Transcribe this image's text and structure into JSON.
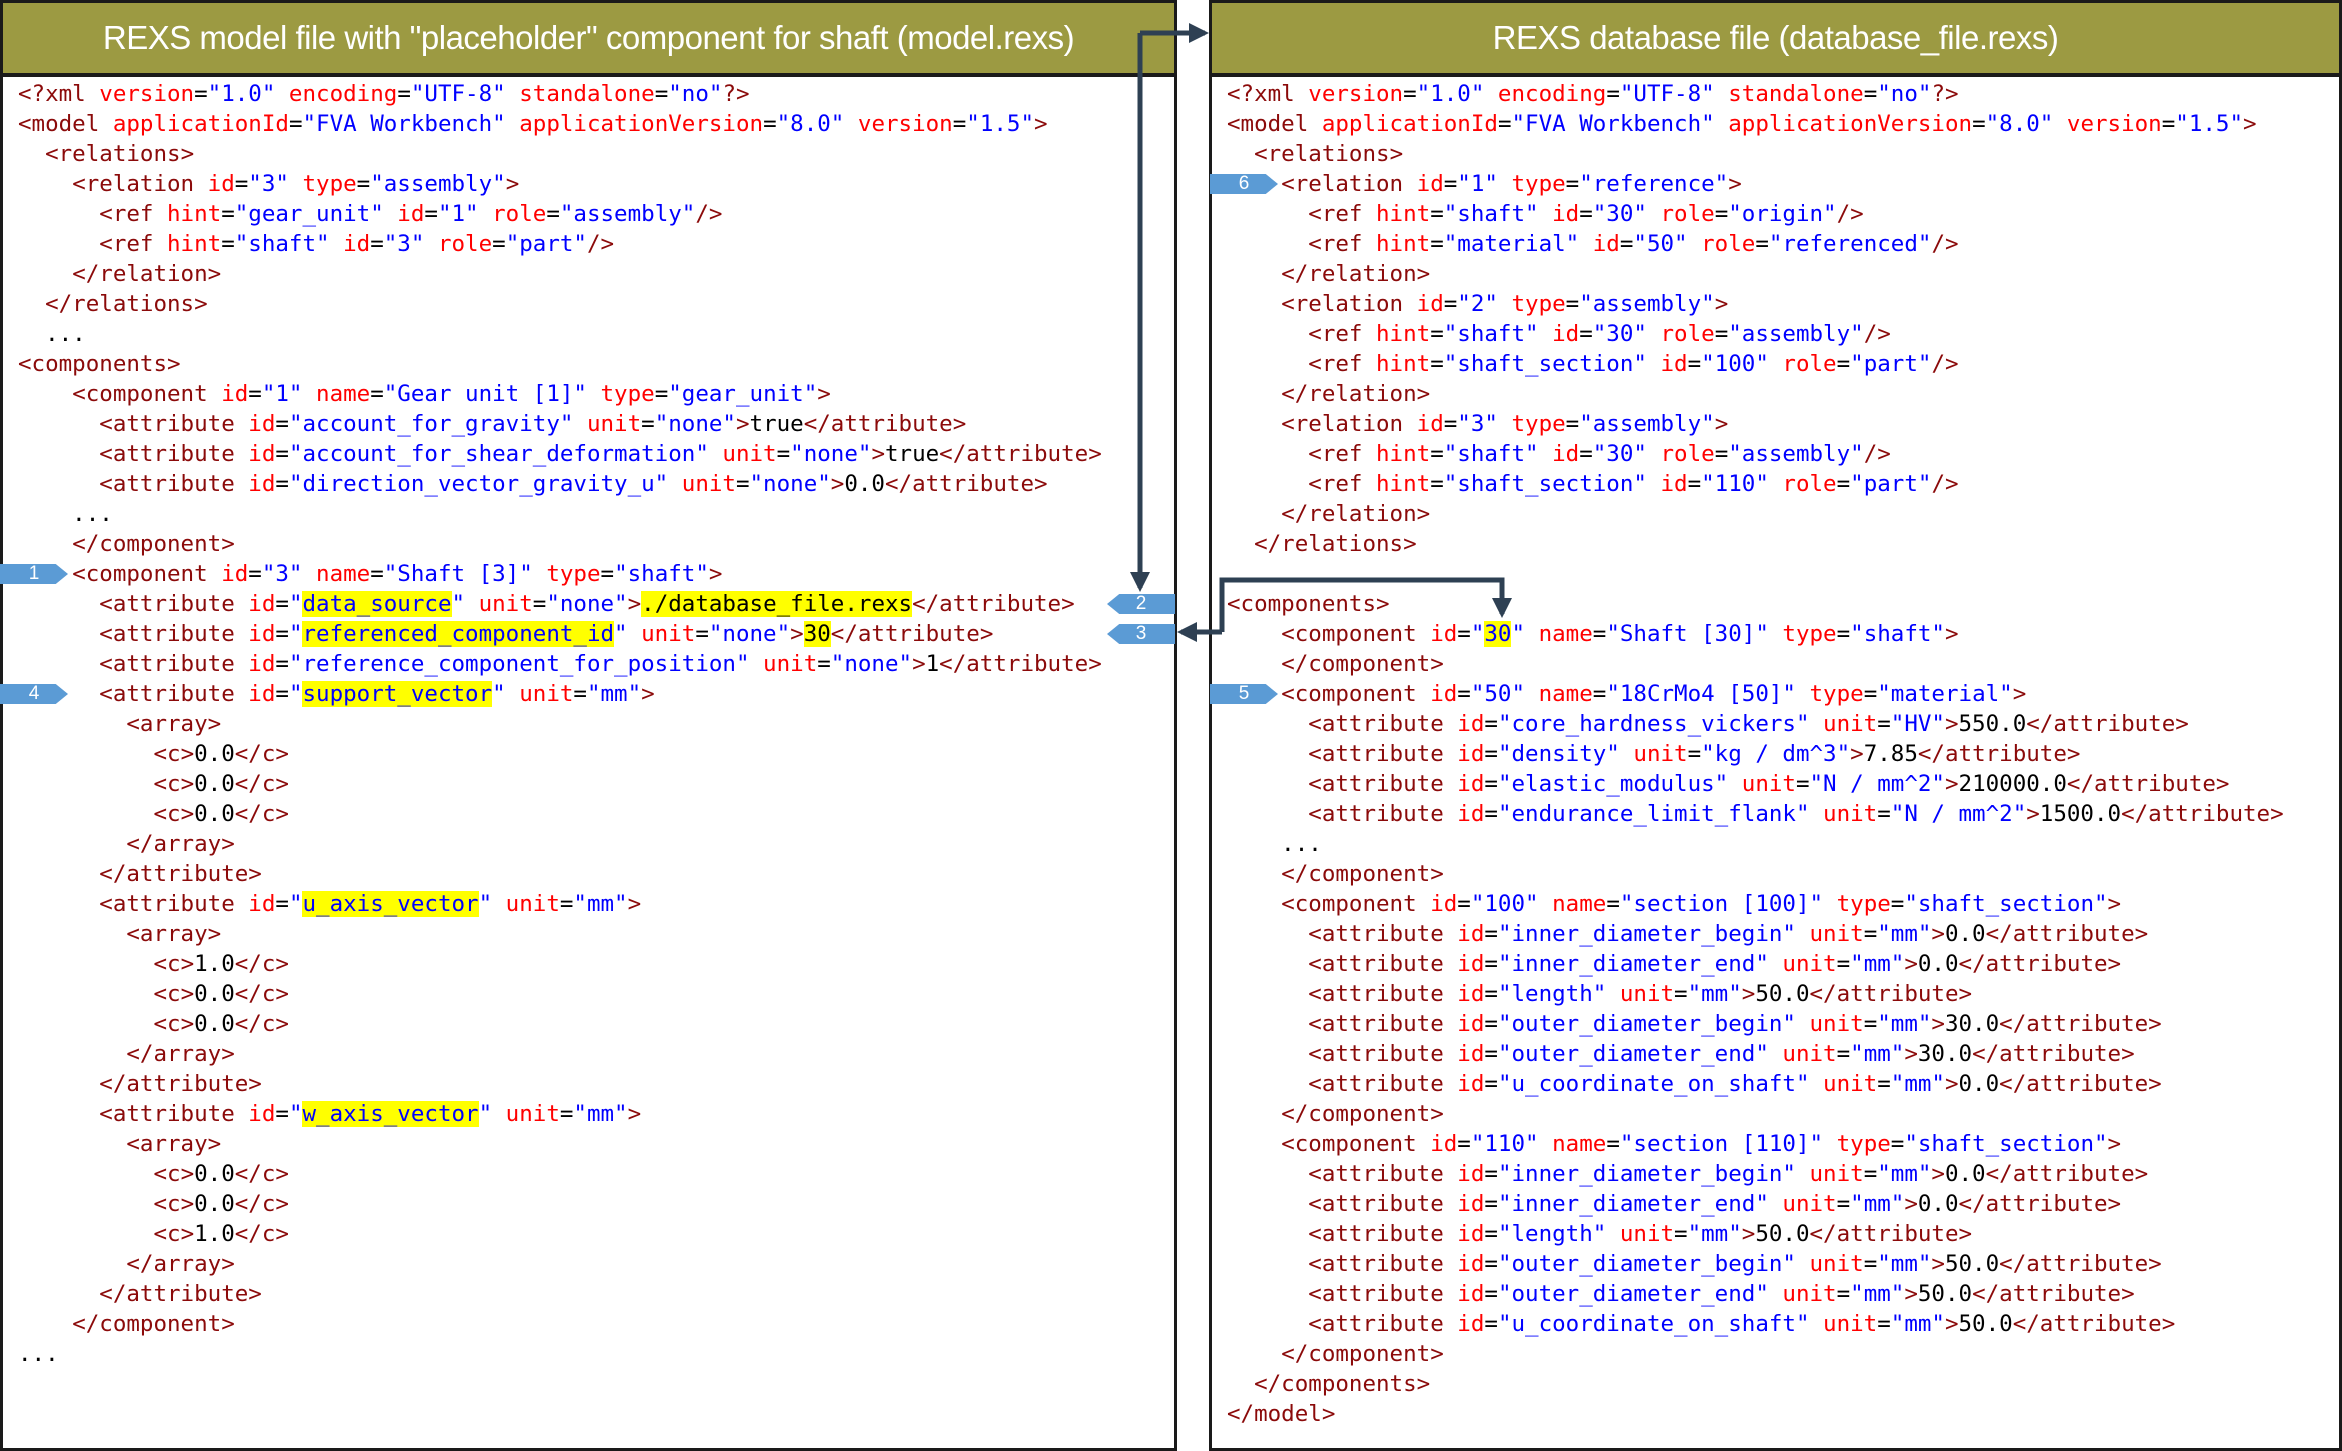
{
  "left_panel": {
    "title": "REXS model file with \"placeholder\" component for shaft (model.rexs)",
    "lines": [
      "<?xml version=\"1.0\" encoding=\"UTF-8\" standalone=\"no\"?>",
      "<model applicationId=\"FVA Workbench\" applicationVersion=\"8.0\" version=\"1.5\">",
      "  <relations>",
      "    <relation id=\"3\" type=\"assembly\">",
      "      <ref hint=\"gear_unit\" id=\"1\" role=\"assembly\"/>",
      "      <ref hint=\"shaft\" id=\"3\" role=\"part\"/>",
      "    </relation>",
      "  </relations>",
      "  ...",
      "<components>",
      "    <component id=\"1\" name=\"Gear unit [1]\" type=\"gear_unit\">",
      "      <attribute id=\"account_for_gravity\" unit=\"none\">true</attribute>",
      "      <attribute id=\"account_for_shear_deformation\" unit=\"none\">true</attribute>",
      "      <attribute id=\"direction_vector_gravity_u\" unit=\"none\">0.0</attribute>",
      "    ...",
      "    </component>",
      "    <component id=\"3\" name=\"Shaft [3]\" type=\"shaft\">",
      "      <attribute id=\"data_source\" unit=\"none\">./database_file.rexs</attribute>",
      "      <attribute id=\"referenced_component_id\" unit=\"none\">30</attribute>",
      "      <attribute id=\"reference_component_for_position\" unit=\"none\">1</attribute>",
      "      <attribute id=\"support_vector\" unit=\"mm\">",
      "        <array>",
      "          <c>0.0</c>",
      "          <c>0.0</c>",
      "          <c>0.0</c>",
      "        </array>",
      "      </attribute>",
      "      <attribute id=\"u_axis_vector\" unit=\"mm\">",
      "        <array>",
      "          <c>1.0</c>",
      "          <c>0.0</c>",
      "          <c>0.0</c>",
      "        </array>",
      "      </attribute>",
      "      <attribute id=\"w_axis_vector\" unit=\"mm\">",
      "        <array>",
      "          <c>0.0</c>",
      "          <c>0.0</c>",
      "          <c>1.0</c>",
      "        </array>",
      "      </attribute>",
      "    </component>",
      "..."
    ],
    "highlights": {
      "17": [
        "data_source",
        "./database_file.rexs"
      ],
      "18": [
        "referenced_component_id",
        "30"
      ],
      "20": [
        "support_vector"
      ],
      "27": [
        "u_axis_vector"
      ],
      "34": [
        "w_axis_vector"
      ]
    },
    "badges": [
      {
        "label": "1",
        "line": 16,
        "side": "left"
      },
      {
        "label": "2",
        "line": 17,
        "side": "right"
      },
      {
        "label": "3",
        "line": 18,
        "side": "right"
      },
      {
        "label": "4",
        "line": 20,
        "side": "left"
      }
    ]
  },
  "right_panel": {
    "title": "REXS database file (database_file.rexs)",
    "lines": [
      "<?xml version=\"1.0\" encoding=\"UTF-8\" standalone=\"no\"?>",
      "<model applicationId=\"FVA Workbench\" applicationVersion=\"8.0\" version=\"1.5\">",
      "  <relations>",
      "    <relation id=\"1\" type=\"reference\">",
      "      <ref hint=\"shaft\" id=\"30\" role=\"origin\"/>",
      "      <ref hint=\"material\" id=\"50\" role=\"referenced\"/>",
      "    </relation>",
      "    <relation id=\"2\" type=\"assembly\">",
      "      <ref hint=\"shaft\" id=\"30\" role=\"assembly\"/>",
      "      <ref hint=\"shaft_section\" id=\"100\" role=\"part\"/>",
      "    </relation>",
      "    <relation id=\"3\" type=\"assembly\">",
      "      <ref hint=\"shaft\" id=\"30\" role=\"assembly\"/>",
      "      <ref hint=\"shaft_section\" id=\"110\" role=\"part\"/>",
      "    </relation>",
      "  </relations>",
      "",
      "<components>",
      "    <component id=\"30\" name=\"Shaft [30]\" type=\"shaft\">",
      "    </component>",
      "    <component id=\"50\" name=\"18CrMo4 [50]\" type=\"material\">",
      "      <attribute id=\"core_hardness_vickers\" unit=\"HV\">550.0</attribute>",
      "      <attribute id=\"density\" unit=\"kg / dm^3\">7.85</attribute>",
      "      <attribute id=\"elastic_modulus\" unit=\"N / mm^2\">210000.0</attribute>",
      "      <attribute id=\"endurance_limit_flank\" unit=\"N / mm^2\">1500.0</attribute>",
      "    ...",
      "    </component>",
      "    <component id=\"100\" name=\"section [100]\" type=\"shaft_section\">",
      "      <attribute id=\"inner_diameter_begin\" unit=\"mm\">0.0</attribute>",
      "      <attribute id=\"inner_diameter_end\" unit=\"mm\">0.0</attribute>",
      "      <attribute id=\"length\" unit=\"mm\">50.0</attribute>",
      "      <attribute id=\"outer_diameter_begin\" unit=\"mm\">30.0</attribute>",
      "      <attribute id=\"outer_diameter_end\" unit=\"mm\">30.0</attribute>",
      "      <attribute id=\"u_coordinate_on_shaft\" unit=\"mm\">0.0</attribute>",
      "    </component>",
      "    <component id=\"110\" name=\"section [110]\" type=\"shaft_section\">",
      "      <attribute id=\"inner_diameter_begin\" unit=\"mm\">0.0</attribute>",
      "      <attribute id=\"inner_diameter_end\" unit=\"mm\">0.0</attribute>",
      "      <attribute id=\"length\" unit=\"mm\">50.0</attribute>",
      "      <attribute id=\"outer_diameter_begin\" unit=\"mm\">50.0</attribute>",
      "      <attribute id=\"outer_diameter_end\" unit=\"mm\">50.0</attribute>",
      "      <attribute id=\"u_coordinate_on_shaft\" unit=\"mm\">50.0</attribute>",
      "    </component>",
      "  </components>",
      "</model>"
    ],
    "highlights": {
      "18": [
        "30"
      ]
    },
    "badges": [
      {
        "label": "6",
        "line": 3,
        "side": "left"
      },
      {
        "label": "5",
        "line": 20,
        "side": "left"
      }
    ]
  },
  "colors": {
    "header_bg": "#9c9a42",
    "tag": "#8b0a0a",
    "attribute_name": "#ff0000",
    "attribute_value": "#0000ff",
    "highlight": "#ffff00",
    "badge": "#5b9bd5",
    "arrow": "#2e4053"
  }
}
